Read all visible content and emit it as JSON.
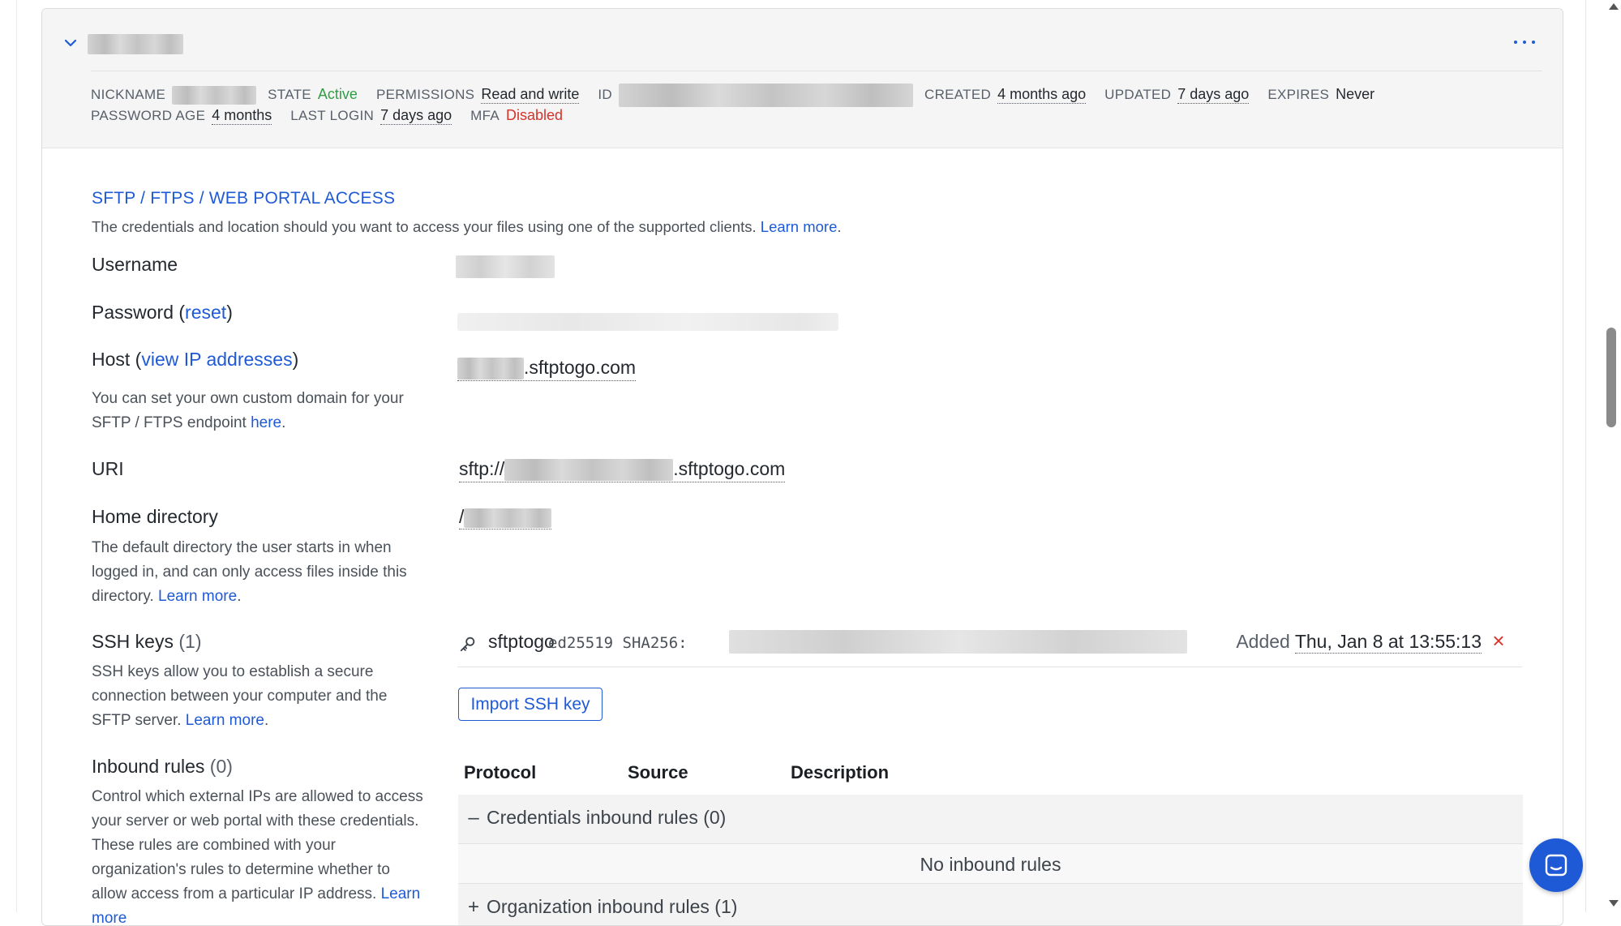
{
  "meta": {
    "nickname_label": "NICKNAME",
    "state_label": "STATE",
    "state_value": "Active",
    "permissions_label": "PERMISSIONS",
    "permissions_value": "Read and write",
    "id_label": "ID",
    "created_label": "CREATED",
    "created_value": "4 months ago",
    "updated_label": "UPDATED",
    "updated_value": "7 days ago",
    "expires_label": "EXPIRES",
    "expires_value": "Never",
    "password_age_label": "PASSWORD AGE",
    "password_age_value": "4 months",
    "last_login_label": "LAST LOGIN",
    "last_login_value": "7 days ago",
    "mfa_label": "MFA",
    "mfa_value": "Disabled"
  },
  "access": {
    "title": "SFTP / FTPS / WEB PORTAL ACCESS",
    "desc": "The credentials and location should you want to access your files using one of the supported clients.",
    "learn_more": "Learn more",
    "dot": "."
  },
  "username": {
    "label": "Username"
  },
  "password": {
    "label": "Password",
    "paren_open": " (",
    "reset": "reset",
    "paren_close": ")"
  },
  "host": {
    "label": "Host",
    "paren_open": " (",
    "link": "view IP addresses",
    "paren_close": ")",
    "desc": "You can set your own custom domain for your SFTP / FTPS endpoint ",
    "here": "here",
    "dot": ".",
    "value_suffix": ".sftptogo.com"
  },
  "uri": {
    "label": "URI",
    "prefix": "sftp://",
    "suffix": ".sftptogo.com"
  },
  "home": {
    "label": "Home directory",
    "desc": "The default directory the user starts in when logged in, and can only access files inside this directory. ",
    "learn_more": "Learn more",
    "dot": ".",
    "value_prefix": "/"
  },
  "ssh": {
    "label": "SSH keys",
    "count": "(1)",
    "desc": "SSH keys allow you to establish a secure connection between your computer and the SFTP server. ",
    "learn_more": "Learn more",
    "dot": ".",
    "key_name": "sftptogo",
    "key_type": "ed25519 SHA256:",
    "added_label": "Added ",
    "added_value": "Thu, Jan 8 at 13:55:13",
    "delete_glyph": "×",
    "import_button": "Import SSH key"
  },
  "inbound": {
    "label": "Inbound rules",
    "count": "(0)",
    "desc": "Control which external IPs are allowed to access your server or web portal with these credentials. These rules are combined with your organization's rules to determine whether to allow access from a particular IP address. ",
    "learn_more": "Learn more",
    "col_protocol": "Protocol",
    "col_source": "Source",
    "col_description": "Description",
    "cred_sign": "–",
    "cred_rules": "Credentials inbound rules (0)",
    "empty": "No inbound rules",
    "org_sign": "+",
    "org_rules": "Organization inbound rules (1)"
  },
  "colors": {
    "accent": "#1f5ad6",
    "active": "#2f9e44",
    "danger": "#d6332b"
  },
  "icons": [
    "chevron-down-icon",
    "more-horizontal-icon",
    "key-icon",
    "close-icon",
    "chat-icon"
  ]
}
